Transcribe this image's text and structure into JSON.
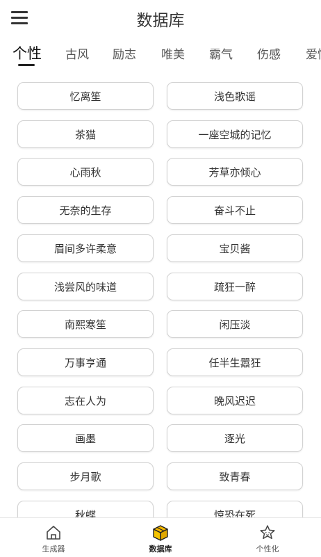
{
  "header": {
    "title": "数据库"
  },
  "tabs": [
    "个性",
    "古风",
    "励志",
    "唯美",
    "霸气",
    "伤感",
    "爱情"
  ],
  "active_tab": 0,
  "names": [
    [
      "忆离笙",
      "浅色歌谣"
    ],
    [
      "茶猫",
      "一座空城的记忆"
    ],
    [
      "心雨秋",
      "芳草亦倾心"
    ],
    [
      "无奈的生存",
      "奋斗不止"
    ],
    [
      "眉间多许柔意",
      "宝贝酱"
    ],
    [
      "浅尝风的味道",
      "疏狂一醉"
    ],
    [
      "南熙寒笙",
      "闲压淡"
    ],
    [
      "万事亨通",
      "任半生嚣狂"
    ],
    [
      "志在人为",
      "晚风迟迟"
    ],
    [
      "画墨",
      "逐光"
    ],
    [
      "步月歌",
      "致青春"
    ],
    [
      "秋蝶",
      "惊恐在死"
    ]
  ],
  "bottom_nav": [
    {
      "label": "生成器",
      "icon": "home-icon"
    },
    {
      "label": "数据库",
      "icon": "database-box-icon"
    },
    {
      "label": "个性化",
      "icon": "star-face-icon"
    }
  ],
  "active_nav": 1,
  "colors": {
    "accent": "#f5b800",
    "text": "#333333",
    "border": "#d2d2d2"
  }
}
